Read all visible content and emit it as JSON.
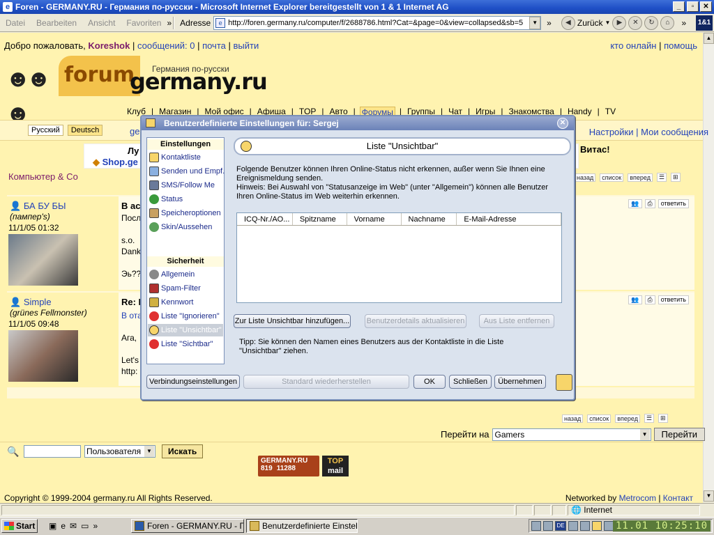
{
  "window": {
    "title": "Foren - GERMANY.RU - Германия по-русски - Microsoft Internet Explorer bereitgestellt von 1 & 1 Internet AG"
  },
  "menubar": {
    "items": [
      "Datei",
      "Bearbeiten",
      "Ansicht",
      "Favoriten"
    ],
    "more": "»",
    "address_label": "Adresse",
    "url": "http://foren.germany.ru/computer/f/2688786.html?Cat=&page=0&view=collapsed&sb=5",
    "back_label": "Zurück",
    "brand": "1&1"
  },
  "site": {
    "welcome_prefix": "Добро пожаловать,",
    "username": "Koreshok",
    "messages": "сообщений: 0",
    "mail": "почта",
    "logout": "выйти",
    "who_online": "кто онлайн",
    "help": "помощь",
    "logo_word": "forum",
    "logo_site": "germany.ru",
    "logo_tagline": "Германия по-русски",
    "nav": [
      "Клуб",
      "Магазин",
      "Мой офис",
      "Афиша",
      "TOP",
      "Авто",
      "Форумы",
      "Группы",
      "Чат",
      "Игры",
      "Знакомства",
      "Handy",
      "TV"
    ],
    "nav_selected": "Форумы",
    "lang_ru": "Русский",
    "lang_de": "Deutsch",
    "sub_prefix": "ge",
    "settings_link": "Настройки",
    "my_messages": "Мои сообщения",
    "banner_line1": "Лу",
    "banner_line2": "Shop.ge",
    "banner_right": "Витас!",
    "breadcrumb": "Компьютер & Co",
    "nav_back": "назад",
    "nav_list": "список",
    "nav_forward": "вперед",
    "reply": "ответить"
  },
  "posts": [
    {
      "user": "БА БУ БЫ",
      "status": "(пампер's)",
      "date": "11/1/05 01:32",
      "subject": "В ас",
      "lines": [
        "Посл",
        "s.o.",
        "Dank",
        "Эь??"
      ]
    },
    {
      "user": "Simple",
      "status": "(grünes Fellmonster)",
      "date": "11/1/05 09:48",
      "subject": "Re: I",
      "lines": [
        "В ота",
        "Ага,",
        "Let's",
        "http:"
      ]
    }
  ],
  "footer": {
    "goto_label": "Перейти на",
    "goto_value": "Gamers",
    "goto_button": "Перейти",
    "search_type": "Пользователя",
    "search_button": "Искать",
    "badge_site": "GERMANY.RU",
    "badge_n1": "819",
    "badge_n2": "11288",
    "badge_top": "TOP",
    "badge_mail": "mail",
    "copyright": "Copyright © 1999-2004 germany.ru All Rights Reserved.",
    "networked_prefix": "Networked by",
    "networked_link": "Metrocom",
    "contact": "Контакт"
  },
  "dialog": {
    "title": "Benutzerdefinierte Einstellungen für: Sergej",
    "left_heading1": "Einstellungen",
    "left_items1": [
      "Kontaktliste",
      "Senden und Empf.",
      "SMS/Follow Me",
      "Status",
      "Speicheroptionen",
      "Skin/Aussehen"
    ],
    "left_heading2": "Sicherheit",
    "left_items2": [
      "Allgemein",
      "Spam-Filter",
      "Kennwort",
      "Liste \"Ignorieren\"",
      "Liste \"Unsichtbar\"",
      "Liste \"Sichtbar\""
    ],
    "selected": "Liste \"Unsichtbar\"",
    "panel_title": "Liste \"Unsichtbar\"",
    "desc1": "Folgende Benutzer können Ihren Online-Status nicht erkennen, außer wenn Sie Ihnen eine Ereignismeldung senden.",
    "desc2": "Hinweis: Bei Auswahl von \"Statusanzeige im Web\" (unter \"Allgemein\") können alle Benutzer Ihren Online-Status im Web weiterhin erkennen.",
    "columns": [
      "ICQ-Nr./AO...",
      "Spitzname",
      "Vorname",
      "Nachname",
      "E-Mail-Adresse"
    ],
    "btn_add": "Zur Liste Unsichtbar hinzufügen...",
    "btn_update": "Benutzerdetails aktualisieren",
    "btn_remove": "Aus Liste entfernen",
    "tip": "Tipp: Sie können den Namen eines Benutzers aus der Kontaktliste in die Liste \"Unsichtbar\" ziehen.",
    "btn_connection": "Verbindungseinstellungen",
    "btn_restore": "Standard wiederherstellen",
    "btn_ok": "OK",
    "btn_close": "Schließen",
    "btn_apply": "Übernehmen"
  },
  "statusbar": {
    "zone": "Internet"
  },
  "taskbar": {
    "start": "Start",
    "task1": "Foren - GERMANY.RU - Г...",
    "task2": "Benutzerdefinierte Einstel...",
    "lang": "DE",
    "date": "11.01",
    "time": "10:25:10"
  }
}
